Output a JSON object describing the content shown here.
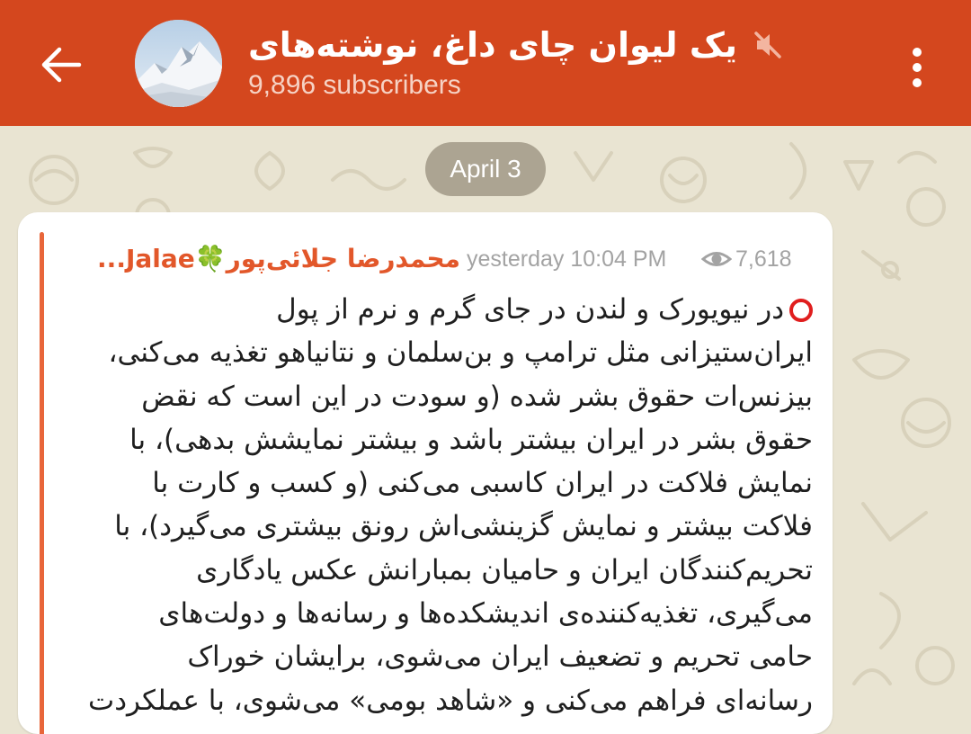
{
  "header": {
    "channel_title": "یک لیوان چای داغ، نوشته‌های حا...",
    "subscribers": "9,896 subscribers",
    "background_color": "#d4471e",
    "back_icon": "arrow-left-icon",
    "mute_icon": "speaker-muted-icon",
    "menu_icon": "more-vertical-icon"
  },
  "date_chip": {
    "label": "April 3"
  },
  "message": {
    "sender": "محمدرضا جلائی‌پور🍀Jalae...",
    "timestamp": "yesterday 10:04 PM",
    "views": "7,618",
    "views_icon": "eye-icon",
    "accent_color": "#e2572a",
    "lines": [
      "⭕ در نیویورک و لندن در جای گرم و نرم از پول",
      "ایران‌ستیزانی مثل ترامپ و بن‌سلمان و نتانیاهو تغذیه می‌کنی،",
      "بیزنس‌ات حقوق بشر شده (و سودت در این است که نقض",
      "حقوق بشر  در ایران بیشتر باشد و بیشتر نمایشش بدهی)، با",
      "نمایش فلاکت در ایران کاسبی می‌کنی (و کسب و کارت با",
      "فلاکت بیشتر و نمایش گزینشی‌اش رونق بیشتری می‌گیرد)، با",
      "تحریم‌کنندگان ایران و حامیان بمبارانش عکس یادگاری",
      "می‌گیری، تغذیه‌کننده‌ی اندیشکده‌ها و رسانه‌ها و دولت‌های",
      "حامی تحریم و تضعیف ایران می‌شوی، برایشان خوراک",
      "رسانه‌ای فراهم می‌کنی و «شاهد بومی» می‌شوی، با عملکردت"
    ]
  }
}
